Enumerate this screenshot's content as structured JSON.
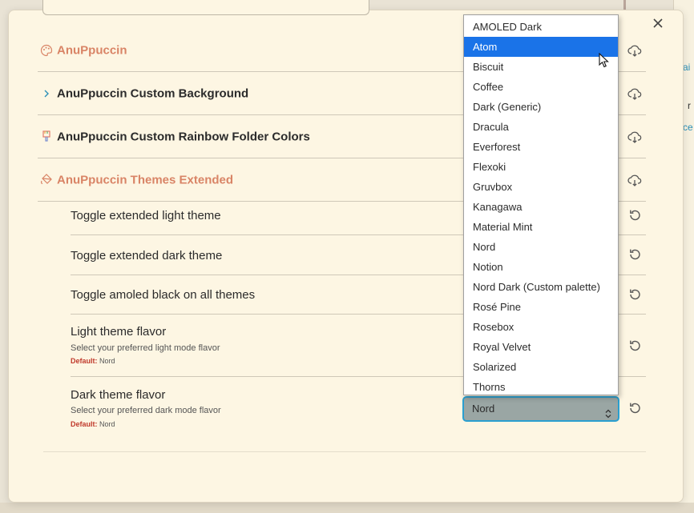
{
  "background": {
    "right_texts": [
      "ai",
      "r",
      "ce"
    ]
  },
  "modal": {
    "close_icon": "close-icon"
  },
  "plugins": [
    {
      "name": "AnuPpuccin",
      "icon": "palette-icon",
      "style": "accent",
      "action_icon": "download-icon"
    },
    {
      "name": "AnuPpuccin Custom Background",
      "icon": "chevron-right-icon",
      "style": "dark",
      "action_icon": "download-icon"
    },
    {
      "name": "AnuPpuccin Custom Rainbow Folder Colors",
      "icon": "brush-icon",
      "style": "dark",
      "action_icon": "download-icon"
    },
    {
      "name": "AnuPpuccin Themes Extended",
      "icon": "paint-bucket-icon",
      "style": "accent",
      "action_icon": "download-icon"
    }
  ],
  "settings": [
    {
      "name": "Toggle extended light theme"
    },
    {
      "name": "Toggle extended dark theme"
    },
    {
      "name": "Toggle amoled black on all themes"
    },
    {
      "name": "Light theme flavor",
      "description": "Select your preferred light mode flavor",
      "default_label": "Default:",
      "default_value": "Nord"
    },
    {
      "name": "Dark theme flavor",
      "description": "Select your preferred dark mode flavor",
      "default_label": "Default:",
      "default_value": "Nord"
    }
  ],
  "select": {
    "value": "Nord"
  },
  "dropdown": {
    "selected": "Atom",
    "options": [
      "AMOLED Dark",
      "Atom",
      "Biscuit",
      "Coffee",
      "Dark (Generic)",
      "Dracula",
      "Everforest",
      "Flexoki",
      "Gruvbox",
      "Kanagawa",
      "Material Mint",
      "Nord",
      "Notion",
      "Nord Dark (Custom palette)",
      "Rosé Pine",
      "Rosebox",
      "Royal Velvet",
      "Solarized",
      "Thorns"
    ]
  },
  "colors": {
    "accent": "#d98466",
    "selection": "#1a73e8",
    "focus_ring": "#2a9fd0",
    "default_label": "#c0392b"
  }
}
